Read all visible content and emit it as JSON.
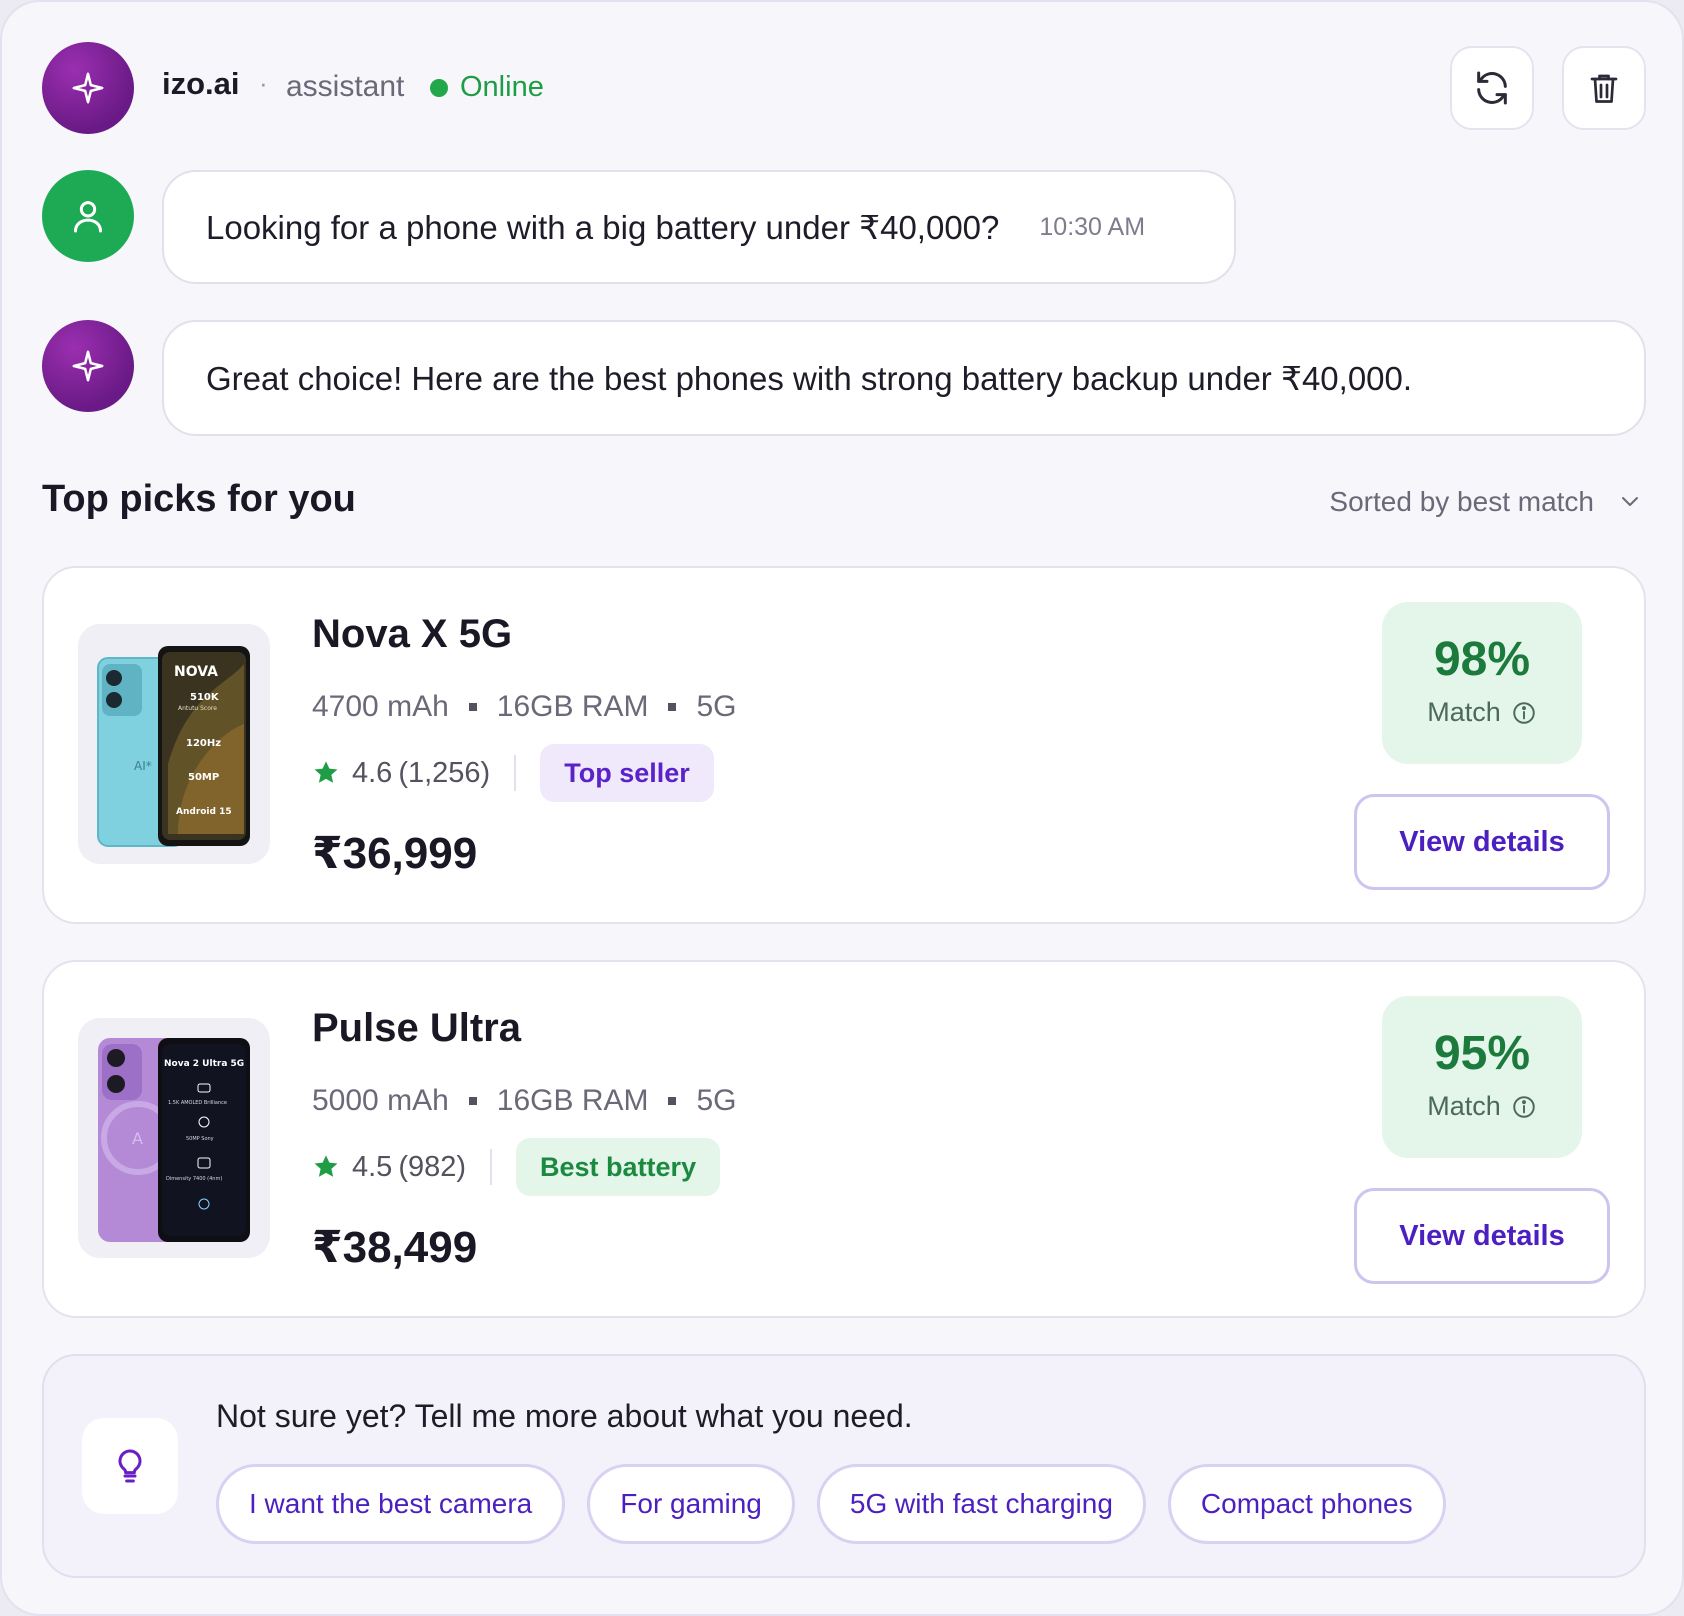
{
  "header": {
    "brand": "izo.ai",
    "separator": "·",
    "role": "assistant",
    "status": "Online",
    "status_color": "#22a84a",
    "actions": [
      {
        "name": "refresh",
        "icon": "refresh-icon"
      },
      {
        "name": "delete",
        "icon": "trash-icon"
      }
    ]
  },
  "messages": [
    {
      "sender": "user",
      "text": "Looking for a phone with a big battery under ₹40,000?",
      "time": "10:30 AM"
    },
    {
      "sender": "assistant",
      "text": "Great choice! Here are the best phones with strong battery backup under ₹40,000."
    }
  ],
  "picks": {
    "title": "Top picks for you",
    "sort_label": "Sorted by best match"
  },
  "products": [
    {
      "name": "Nova X 5G",
      "specs": [
        "4700 mAh",
        "16GB RAM",
        "5G"
      ],
      "rating": "4.6",
      "reviews": "(1,256)",
      "badge": "Top seller",
      "badge_color": "purple",
      "price": "₹36,999",
      "match_pct": "98%",
      "match_label": "Match",
      "cta": "View details",
      "screen_text": {
        "brand": "NOVA",
        "score": "510K",
        "score_sub": "Antutu Score",
        "line2": "120Hz",
        "line3": "50MP",
        "line4": "Android 15",
        "back_logo": "AI*"
      }
    },
    {
      "name": "Pulse Ultra",
      "specs": [
        "5000 mAh",
        "16GB RAM",
        "5G"
      ],
      "rating": "4.5",
      "reviews": "(982)",
      "badge": "Best battery",
      "badge_color": "green",
      "price": "₹38,499",
      "match_pct": "95%",
      "match_label": "Match",
      "cta": "View details",
      "screen_text": {
        "brand": "Nova 2 Ultra 5G",
        "line1": "1.5K AMOLED Brilliance",
        "line2": "50MP Sony",
        "line3": "Dimensity 7400 (4nm)",
        "back_logo": "A"
      }
    }
  ],
  "suggestions": {
    "prompt": "Not sure yet? Tell me more about what you need.",
    "icon": "lightbulb-icon",
    "chips": [
      "I want the best camera",
      "For gaming",
      "5G with fast charging",
      "Compact phones"
    ]
  },
  "colors": {
    "accent": "#4b1fc0",
    "ai_avatar": "#7a1f96",
    "user_avatar": "#1eaa55",
    "match_bg": "#e4f6ea",
    "star": "#1f9d45"
  }
}
